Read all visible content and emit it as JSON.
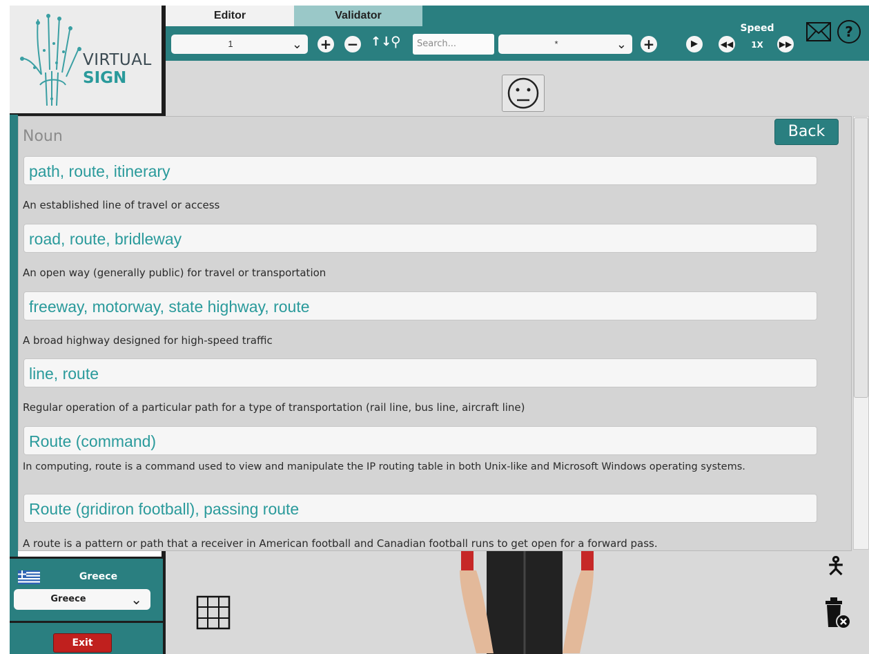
{
  "brand": {
    "line1": "VIRTUAL",
    "line2": "SIGN"
  },
  "tabs": [
    {
      "label": "Editor"
    },
    {
      "label": "Validator"
    }
  ],
  "toolbar": {
    "frame_select_value": "1",
    "search_placeholder": "Search...",
    "filter_select_value": "*",
    "speed_label": "Speed",
    "speed_value": "1X"
  },
  "panel": {
    "part_of_speech": "Noun",
    "back_label": "Back",
    "entries": [
      {
        "terms": "path, route, itinerary",
        "definition": "An established line of travel or access"
      },
      {
        "terms": "road, route, bridleway",
        "definition": "An open way (generally public) for travel or transportation"
      },
      {
        "terms": "freeway, motorway, state highway, route",
        "definition": "A broad highway designed for high-speed traffic"
      },
      {
        "terms": "line, route",
        "definition": "Regular operation of a particular path for a type of transportation (rail line, bus line, aircraft line)"
      },
      {
        "terms": "Route (command)",
        "definition": "In computing, route is a command used to view and manipulate the IP routing table in both Unix-like and Microsoft Windows operating systems."
      },
      {
        "terms": "Route (gridiron football), passing route",
        "definition": "A route is a pattern or path that a receiver in American football and Canadian football runs to get open for a forward pass."
      }
    ]
  },
  "sidebar": {
    "country_label": "Greece",
    "country_select_value": "Greece",
    "exit_label": "Exit"
  },
  "colors": {
    "teal": "#2a7f80",
    "exit_red": "#c0201e"
  }
}
